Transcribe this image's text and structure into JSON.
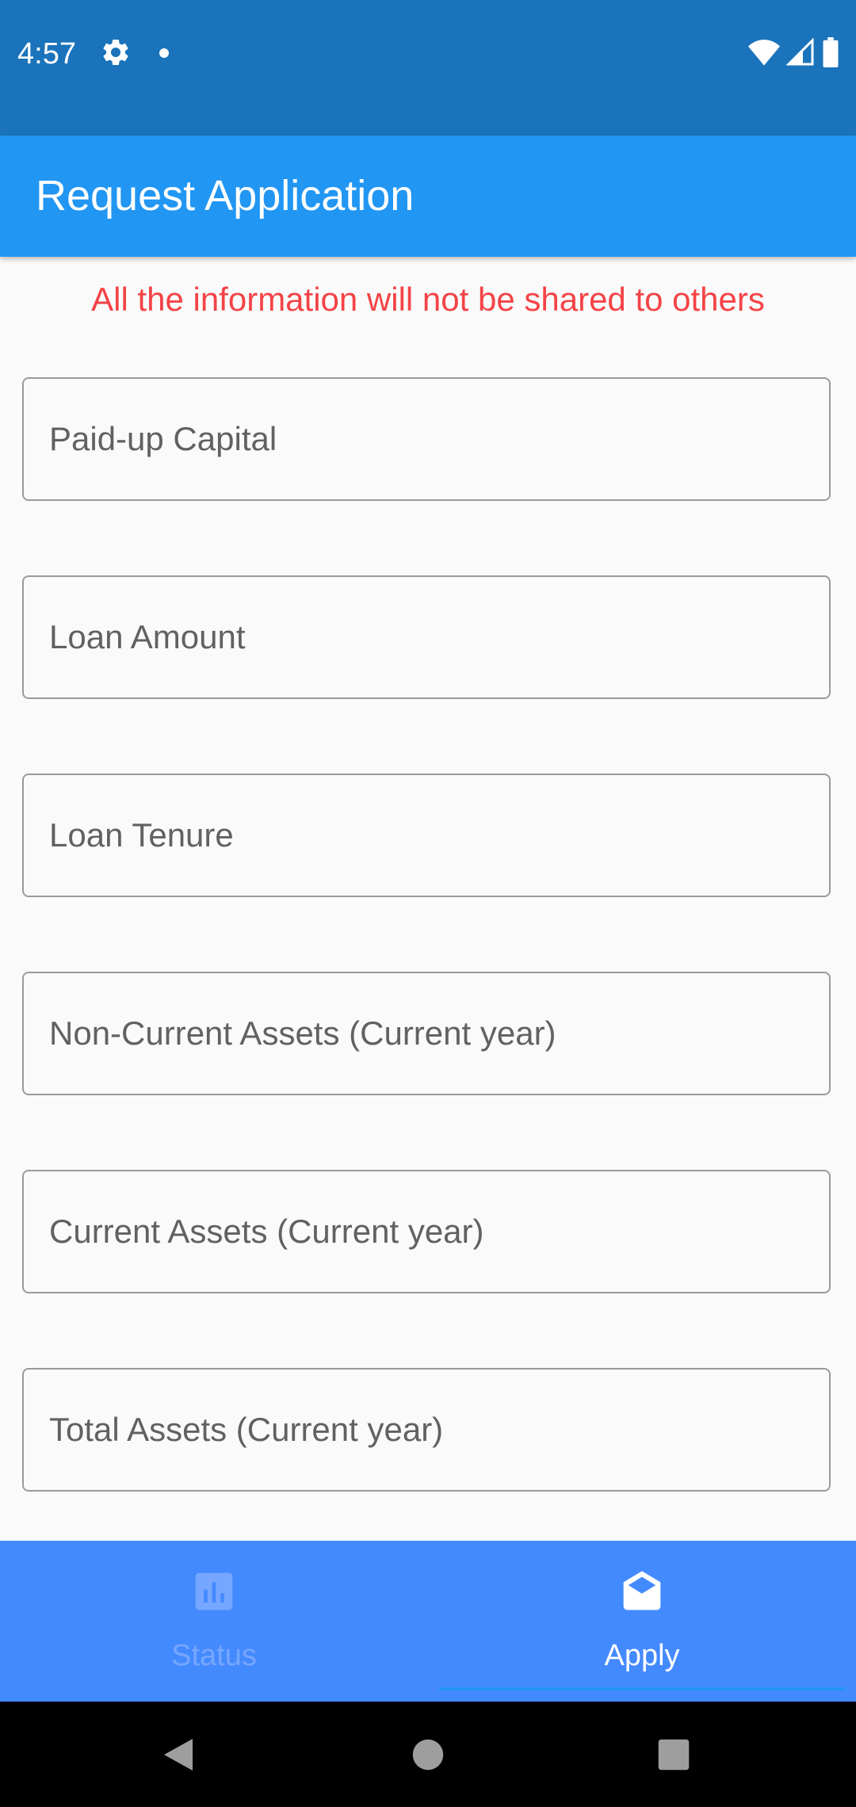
{
  "status_bar": {
    "time": "4:57",
    "icons": [
      "gear-icon",
      "notification-dot-icon",
      "wifi-icon",
      "signal-icon",
      "battery-icon"
    ]
  },
  "app_bar": {
    "title": "Request Application"
  },
  "notice": "All the information will not be shared to others",
  "form": {
    "fields": [
      {
        "placeholder": "Paid-up Capital",
        "value": ""
      },
      {
        "placeholder": "Loan Amount",
        "value": ""
      },
      {
        "placeholder": "Loan Tenure",
        "value": ""
      },
      {
        "placeholder": "Non-Current Assets (Current year)",
        "value": ""
      },
      {
        "placeholder": "Current Assets (Current year)",
        "value": ""
      },
      {
        "placeholder": "Total Assets (Current year)",
        "value": ""
      }
    ]
  },
  "bottom_nav": {
    "items": [
      {
        "label": "Status",
        "icon": "bar-chart-icon",
        "selected": false
      },
      {
        "label": "Apply",
        "icon": "open-mail-icon",
        "selected": true
      }
    ]
  },
  "system_nav": {
    "buttons": [
      "back-icon",
      "home-icon",
      "recents-icon"
    ]
  },
  "colors": {
    "status_bar": "#1a73bb",
    "app_bar": "#2196f3",
    "notice_text": "#f44346",
    "bottom_nav": "#448aff",
    "nav_inactive": "#76a6ff",
    "background": "#fafafa"
  }
}
